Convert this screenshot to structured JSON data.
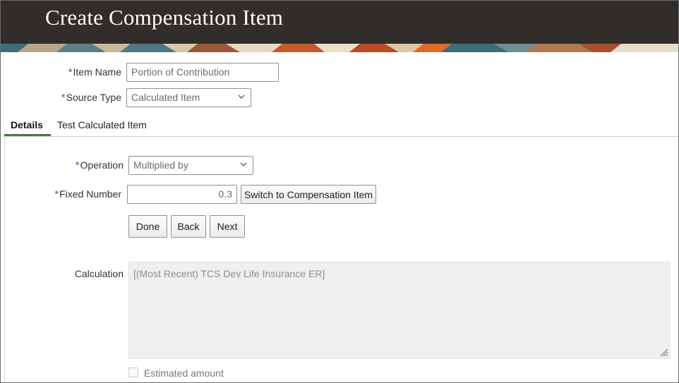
{
  "page": {
    "title": "Create Compensation Item"
  },
  "form": {
    "item_name": {
      "label": "Item Name",
      "required": "*",
      "value": "Portion of Contribution"
    },
    "source_type": {
      "label": "Source Type",
      "required": "*",
      "value": "Calculated Item"
    }
  },
  "tabs": [
    {
      "label": "Details",
      "active": true
    },
    {
      "label": "Test Calculated Item",
      "active": false
    }
  ],
  "details": {
    "operation": {
      "label": "Operation",
      "required": "*",
      "value": "Multiplied by"
    },
    "fixed_number": {
      "label": "Fixed Number",
      "required": "*",
      "value": "0.3"
    },
    "switch_button": "Switch to Compensation Item",
    "buttons": {
      "done": "Done",
      "back": "Back",
      "next": "Next"
    },
    "calculation": {
      "label": "Calculation",
      "value": "[(Most Recent) TCS Dev Life Insurance ER]"
    },
    "estimated_amount": {
      "label": "Estimated amount",
      "checked": false
    }
  },
  "colors": {
    "header_bg": "#312d2a",
    "required_star": "#1f6fb2",
    "tab_underline": "#4a7a3a"
  }
}
